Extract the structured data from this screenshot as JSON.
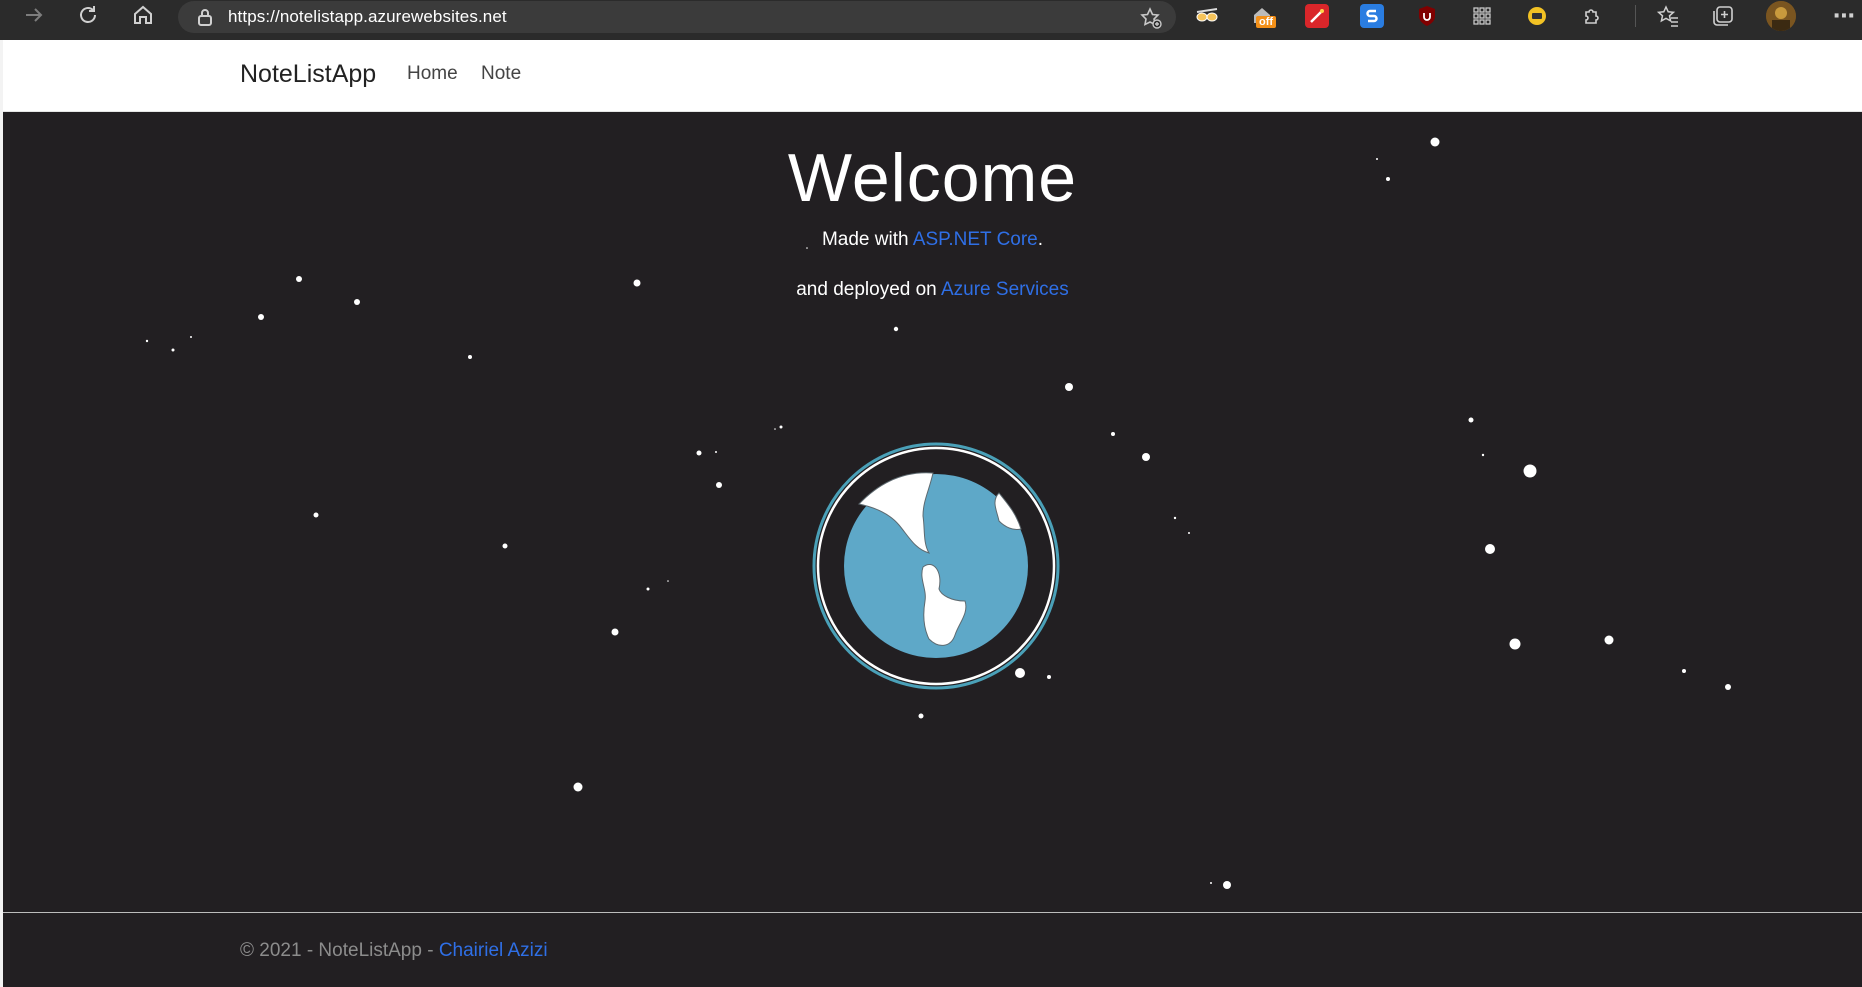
{
  "browser": {
    "url": "https://notelistapp.azurewebsites.net",
    "ext_off_badge": "off"
  },
  "nav": {
    "brand": "NoteListApp",
    "links": [
      "Home",
      "Note"
    ]
  },
  "hero": {
    "title": "Welcome",
    "line1_prefix": "Made with ",
    "line1_link": "ASP.NET Core",
    "line1_suffix": ".",
    "line2_prefix": "and deployed on ",
    "line2_link": "Azure Services"
  },
  "footer": {
    "prefix": "© 2021 - NoteListApp - ",
    "author_link": "Chairiel Azizi"
  },
  "colors": {
    "background": "#221f22",
    "link": "#2f6fe6",
    "globe_water": "#5ea8c8",
    "globe_ring": "#4aa0b8"
  },
  "icons": [
    "forward-arrow-icon",
    "refresh-icon",
    "home-icon",
    "lock-icon",
    "add-favorite-icon",
    "favorites-icon",
    "collections-icon",
    "profile-avatar",
    "more-menu-icon",
    "globe-icon"
  ]
}
